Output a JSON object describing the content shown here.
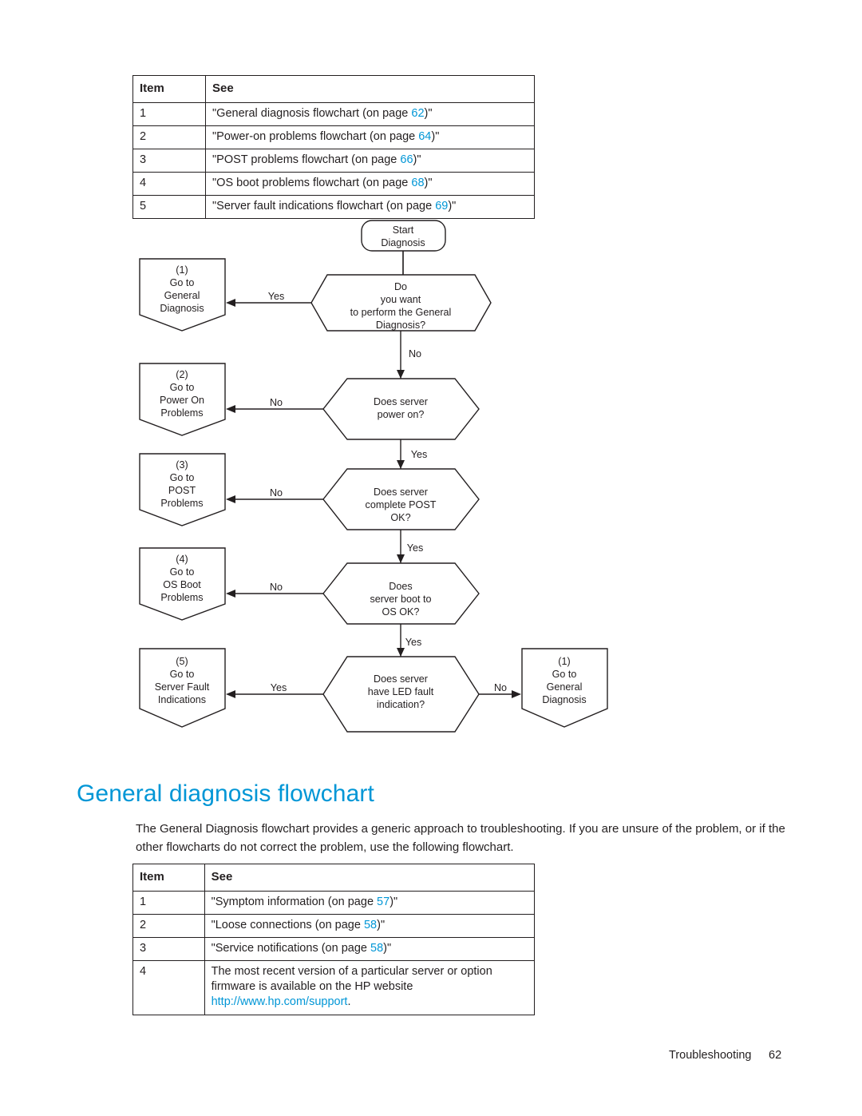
{
  "page": {
    "footer_label": "Troubleshooting",
    "footer_page": "62"
  },
  "table_top": {
    "headers": [
      "Item",
      "See"
    ],
    "rows": [
      {
        "item": "1",
        "pre": "\"General diagnosis flowchart (on page ",
        "page": "62",
        "post": ")\""
      },
      {
        "item": "2",
        "pre": "\"Power-on problems flowchart (on page ",
        "page": "64",
        "post": ")\""
      },
      {
        "item": "3",
        "pre": "\"POST problems flowchart (on page ",
        "page": "66",
        "post": ")\""
      },
      {
        "item": "4",
        "pre": "\"OS boot problems flowchart (on page ",
        "page": "68",
        "post": ")\""
      },
      {
        "item": "5",
        "pre": "\"Server fault indications flowchart (on page ",
        "page": "69",
        "post": ")\""
      }
    ]
  },
  "heading": "General diagnosis flowchart",
  "intro": "The General Diagnosis flowchart provides a generic approach to troubleshooting. If you are unsure of the problem, or if the other flowcharts do not correct the problem, use the following flowchart.",
  "table_bottom": {
    "headers": [
      "Item",
      "See"
    ],
    "rows": [
      {
        "item": "1",
        "pre": "\"Symptom information (on page ",
        "page": "57",
        "post": ")\""
      },
      {
        "item": "2",
        "pre": "\"Loose connections (on page ",
        "page": "58",
        "post": ")\""
      },
      {
        "item": "3",
        "pre": "\"Service notifications (on page ",
        "page": "58",
        "post": ")\""
      }
    ],
    "row4": {
      "item": "4",
      "line1": "The most recent version of a particular server or option",
      "line2": "firmware is available on the HP website",
      "link": "http://www.hp.com/support",
      "line3_tail": "."
    }
  },
  "flowchart": {
    "start": {
      "l1": "Start",
      "l2": "Diagnosis"
    },
    "decisions": [
      {
        "id": "d1",
        "lines": [
          "Do",
          "you want",
          "to perform the General",
          "Diagnosis?"
        ],
        "yes": "Yes",
        "no": "No"
      },
      {
        "id": "d2",
        "lines": [
          "Does server",
          "power on?"
        ],
        "yes": "Yes",
        "no": "No"
      },
      {
        "id": "d3",
        "lines": [
          "Does server",
          "complete POST",
          "OK?"
        ],
        "yes": "Yes",
        "no": "No"
      },
      {
        "id": "d4",
        "lines": [
          "Does",
          "server boot to",
          "OS OK?"
        ],
        "yes": "Yes",
        "no": "No"
      },
      {
        "id": "d5",
        "lines": [
          "Does server",
          "have LED fault",
          "indication?"
        ],
        "yes": "Yes",
        "no": "No"
      }
    ],
    "actions": [
      {
        "id": "a1",
        "num": "(1)",
        "lines": [
          "Go to",
          "General",
          "Diagnosis"
        ]
      },
      {
        "id": "a2",
        "num": "(2)",
        "lines": [
          "Go to",
          "Power On",
          "Problems"
        ]
      },
      {
        "id": "a3",
        "num": "(3)",
        "lines": [
          "Go to",
          "POST",
          "Problems"
        ]
      },
      {
        "id": "a4",
        "num": "(4)",
        "lines": [
          "Go to",
          "OS Boot",
          "Problems"
        ]
      },
      {
        "id": "a5",
        "num": "(5)",
        "lines": [
          "Go to",
          "Server Fault",
          "Indications"
        ]
      },
      {
        "id": "a6",
        "num": "(1)",
        "lines": [
          "Go to",
          "General",
          "Diagnosis"
        ]
      }
    ]
  }
}
